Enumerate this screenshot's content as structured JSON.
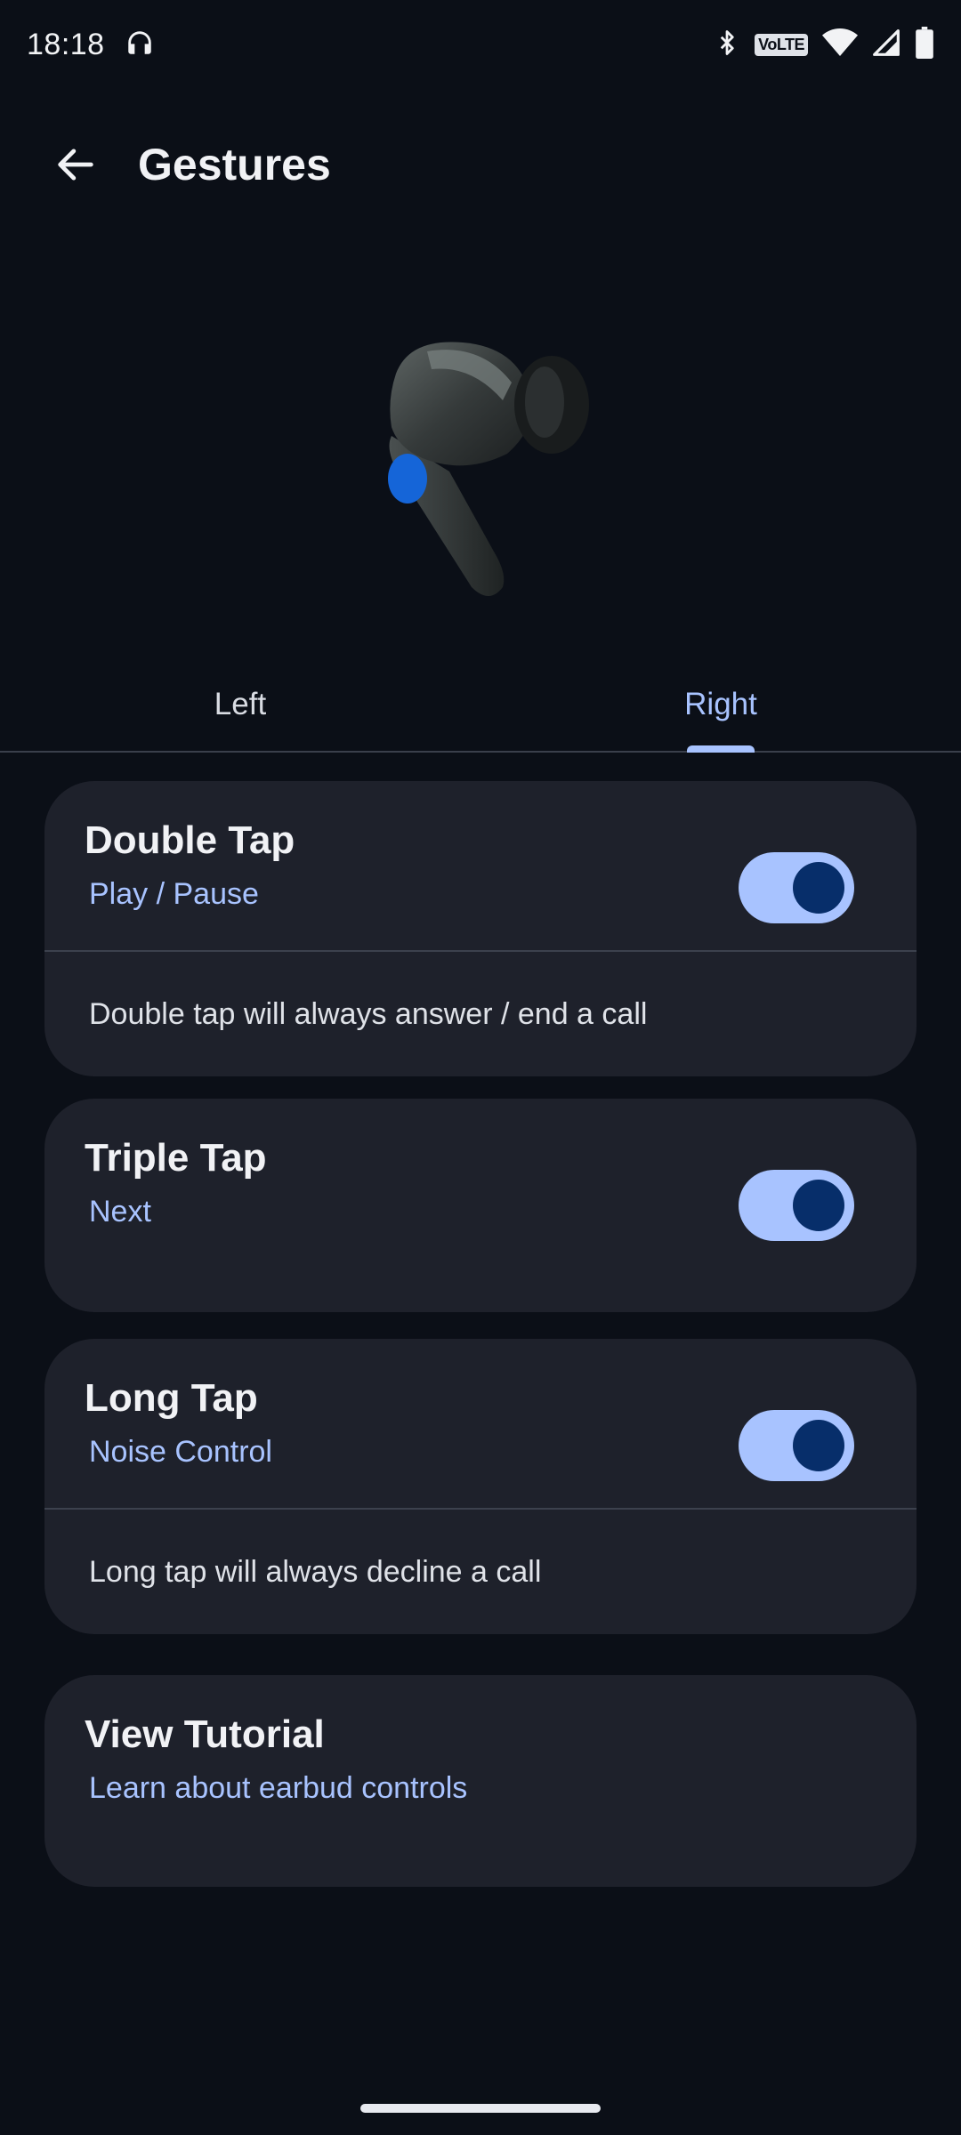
{
  "status_bar": {
    "time": "18:18",
    "volte": "VoLTE",
    "icons": [
      "headphones-icon",
      "bluetooth-icon",
      "volte-icon",
      "wifi-icon",
      "signal-icon",
      "battery-icon"
    ]
  },
  "app_bar": {
    "title": "Gestures",
    "back_icon": "arrow-back-icon"
  },
  "hero": {
    "image": "earbud-image",
    "accent_color": "#1565d8"
  },
  "tabs": [
    {
      "label": "Left",
      "selected": false
    },
    {
      "label": "Right",
      "selected": true
    }
  ],
  "gestures": [
    {
      "title": "Double Tap",
      "action": "Play / Pause",
      "enabled": true,
      "note": "Double tap will always answer / end a call"
    },
    {
      "title": "Triple Tap",
      "action": "Next",
      "enabled": true
    },
    {
      "title": "Long Tap",
      "action": "Noise Control",
      "enabled": true,
      "note": "Long tap will always decline a call"
    }
  ],
  "tutorial": {
    "title": "View Tutorial",
    "subtitle": "Learn about earbud controls"
  },
  "colors": {
    "background": "#0b0f17",
    "card": "#1e212b",
    "accent": "#a8c3ff",
    "toggle_knob": "#072e6a"
  }
}
